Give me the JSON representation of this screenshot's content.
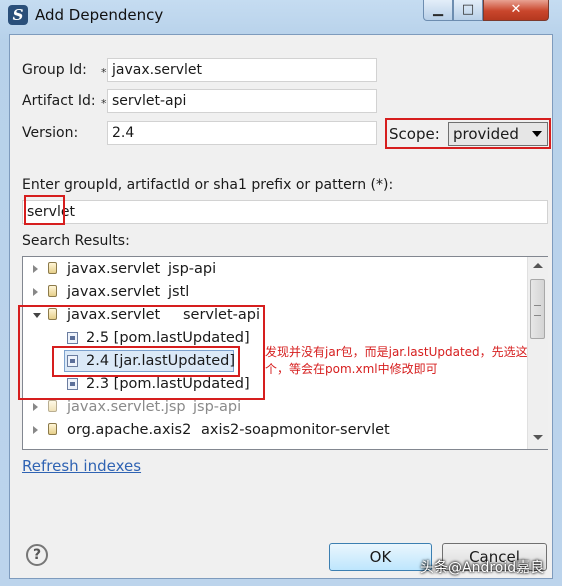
{
  "window": {
    "title": "Add Dependency",
    "app_icon_glyph": "S"
  },
  "form": {
    "group_id": {
      "label": "Group Id:",
      "required": "*",
      "value": "javax.servlet"
    },
    "artifact_id": {
      "label": "Artifact Id:",
      "required": "*",
      "value": "servlet-api"
    },
    "version": {
      "label": "Version:",
      "value": "2.4"
    },
    "scope": {
      "label": "Scope:",
      "value": "provided"
    }
  },
  "search": {
    "prompt": "Enter groupId, artifactId or sha1 prefix or pattern (*):",
    "value": "servlet",
    "results_label": "Search Results:",
    "results": [
      {
        "group": "javax.servlet",
        "artifact": "jsp-api"
      },
      {
        "group": "javax.servlet",
        "artifact": "jstl"
      },
      {
        "group": "javax.servlet",
        "artifact": "servlet-api",
        "versions": [
          "2.5 [pom.lastUpdated]",
          "2.4 [jar.lastUpdated]",
          "2.3 [pom.lastUpdated]"
        ]
      },
      {
        "group": "javax.servlet.jsp",
        "artifact": "jsp-api"
      },
      {
        "group": "org.apache.axis2",
        "artifact": "axis2-soapmonitor-servlet"
      }
    ]
  },
  "annotation": "发现并没有jar包，而是jar.lastUpdated，先选这个，等会在pom.xml中修改即可",
  "links": {
    "refresh": "Refresh indexes"
  },
  "buttons": {
    "ok": "OK",
    "cancel": "Cancel"
  },
  "watermark": "头条@Android嘉良",
  "colors": {
    "highlight_box": "#d61e1e",
    "annotation_text": "#d61e1e",
    "link": "#2f63b3"
  }
}
